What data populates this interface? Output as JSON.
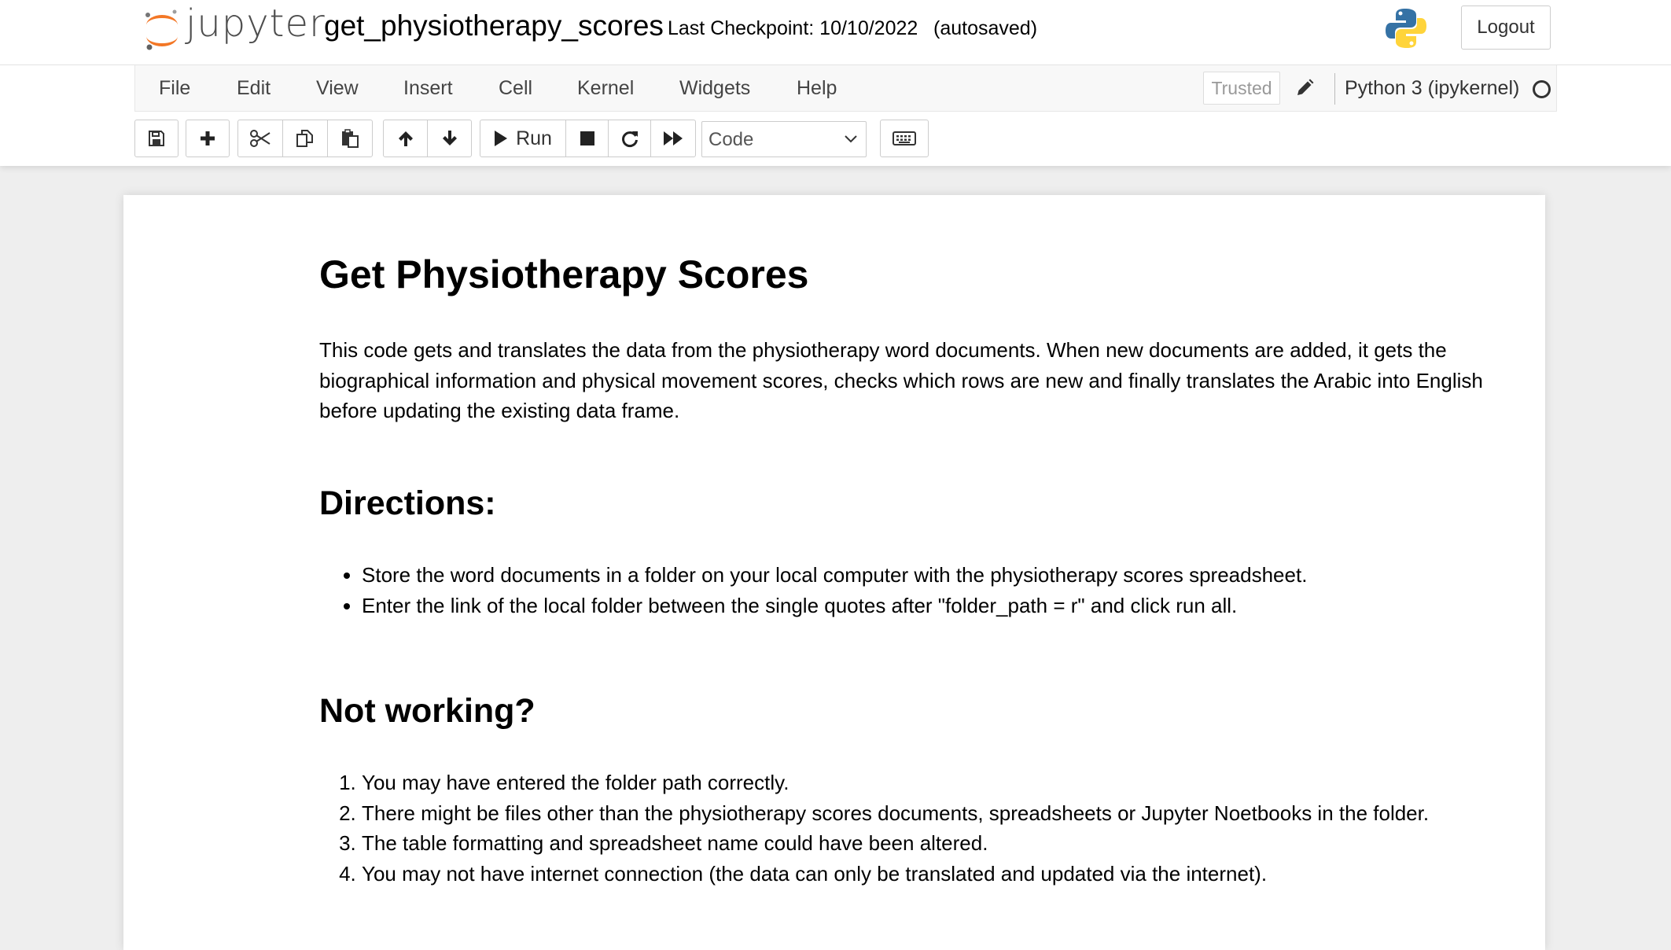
{
  "header": {
    "logo_text": "jupyter",
    "notebook_name": "get_physiotherapy_scores",
    "checkpoint": "Last Checkpoint: 10/10/2022",
    "autosave_status": "(autosaved)",
    "logout_label": "Logout"
  },
  "menubar": {
    "items": [
      "File",
      "Edit",
      "View",
      "Insert",
      "Cell",
      "Kernel",
      "Widgets",
      "Help"
    ],
    "trusted_label": "Trusted",
    "kernel_name": "Python 3 (ipykernel)"
  },
  "toolbar": {
    "run_label": "Run",
    "cell_type": "Code",
    "icons": [
      "save-icon",
      "plus-icon",
      "scissors-icon",
      "copy-icon",
      "paste-icon",
      "arrow-up-icon",
      "arrow-down-icon",
      "play-icon",
      "stop-icon",
      "restart-icon",
      "fast-forward-icon",
      "keyboard-icon"
    ]
  },
  "notebook": {
    "title": "Get Physiotherapy Scores",
    "intro": "This code gets and translates the data from the physiotherapy word documents. When new documents are added, it gets the biographical information and physical movement scores, checks which rows are new and finally translates the Arabic into English before updating the existing data frame.",
    "directions_heading": "Directions:",
    "directions": [
      "Store the word documents in a folder on your local computer with the physiotherapy scores spreadsheet.",
      "Enter the link of the local folder between the single quotes after \"folder_path = r\" and click run all."
    ],
    "not_working_heading": "Not working?",
    "not_working": [
      "You may have entered the folder path correctly.",
      "There might be files other than the physiotherapy scores documents, spreadsheets or Jupyter Noetbooks in the folder.",
      "The table formatting and spreadsheet name could have been altered.",
      "You may not have internet connection (the data can only be translated and updated via the internet)."
    ]
  },
  "colors": {
    "jupyter_orange": "#f37726",
    "page_background": "#eeeeee",
    "python_blue": "#3572a5",
    "python_yellow": "#ffd43b"
  }
}
